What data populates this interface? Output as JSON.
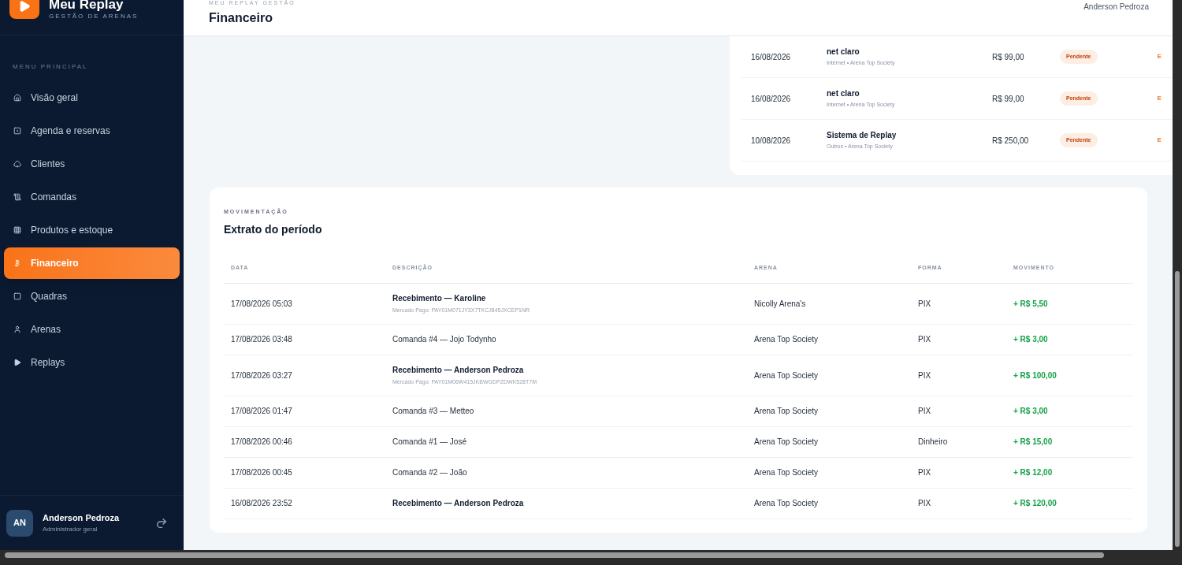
{
  "brand": {
    "name": "Meu Replay",
    "subtitle": "GESTÃO DE ARENAS"
  },
  "sidebar": {
    "section": "MENU PRINCIPAL",
    "items": [
      {
        "label": "Visão geral",
        "selected": false
      },
      {
        "label": "Agenda e reservas",
        "selected": false
      },
      {
        "label": "Clientes",
        "selected": false
      },
      {
        "label": "Comandas",
        "selected": false
      },
      {
        "label": "Produtos e estoque",
        "selected": false
      },
      {
        "label": "Financeiro",
        "selected": true
      },
      {
        "label": "Quadras",
        "selected": false
      },
      {
        "label": "Arenas",
        "selected": false
      },
      {
        "label": "Replays",
        "selected": false
      }
    ]
  },
  "user": {
    "initials": "AN",
    "name": "Anderson Pedroza",
    "role": "Administrador geral"
  },
  "header": {
    "eyebrow": "MEU REPLAY GESTÃO",
    "title": "Financeiro",
    "user": "Anderson Pedroza"
  },
  "pending": {
    "rows": [
      {
        "date": "16/08/2026",
        "title": "net claro",
        "meta": "Internet • Arena Top Society",
        "value": "R$ 99,00",
        "status": "Pendente",
        "action": "E"
      },
      {
        "date": "16/08/2026",
        "title": "net claro",
        "meta": "Internet • Arena Top Society",
        "value": "R$ 99,00",
        "status": "Pendente",
        "action": "E"
      },
      {
        "date": "10/08/2026",
        "title": "Sistema de Replay",
        "meta": "Outros • Arena Top Society",
        "value": "R$ 250,00",
        "status": "Pendente",
        "action": "E"
      }
    ]
  },
  "statement": {
    "eyebrow": "MOVIMENTAÇÃO",
    "title": "Extrato do período",
    "columns": [
      "DATA",
      "DESCRIÇÃO",
      "ARENA",
      "FORMA",
      "MOVIMENTO"
    ],
    "rows": [
      {
        "date": "17/08/2026 05:03",
        "kind": "payment",
        "description": "Recebimento — Karoline",
        "detail": "Mercado Pago: PAY01M071JY3X7TKCJ845JXCEP1NR",
        "arena": "Nicolly Arena's",
        "method": "PIX",
        "amount": "+ R$ 5,50"
      },
      {
        "date": "17/08/2026 03:48",
        "kind": "order",
        "description": "Comanda #4 — Jojo Todynho",
        "arena": "Arena Top Society",
        "method": "PIX",
        "amount": "+ R$ 3,00"
      },
      {
        "date": "17/08/2026 03:27",
        "kind": "payment",
        "description": "Recebimento — Anderson Pedroza",
        "detail": "Mercado Pago: PAY01M06W415JKBWGDPZDWK528T7M",
        "arena": "Arena Top Society",
        "method": "PIX",
        "amount": "+ R$ 100,00"
      },
      {
        "date": "17/08/2026 01:47",
        "kind": "order",
        "description": "Comanda #3 — Metteo",
        "arena": "Arena Top Society",
        "method": "PIX",
        "amount": "+ R$ 3,00"
      },
      {
        "date": "17/08/2026 00:46",
        "kind": "order",
        "description": "Comanda #1 — José",
        "arena": "Arena Top Society",
        "method": "Dinheiro",
        "amount": "+ R$ 15,00"
      },
      {
        "date": "17/08/2026 00:45",
        "kind": "order",
        "description": "Comanda #2 — João",
        "arena": "Arena Top Society",
        "method": "PIX",
        "amount": "+ R$ 12,00"
      },
      {
        "date": "16/08/2026 23:52",
        "kind": "payment",
        "description": "Recebimento — Anderson Pedroza",
        "arena": "Arena Top Society",
        "method": "PIX",
        "amount": "+ R$ 120,00"
      }
    ]
  }
}
